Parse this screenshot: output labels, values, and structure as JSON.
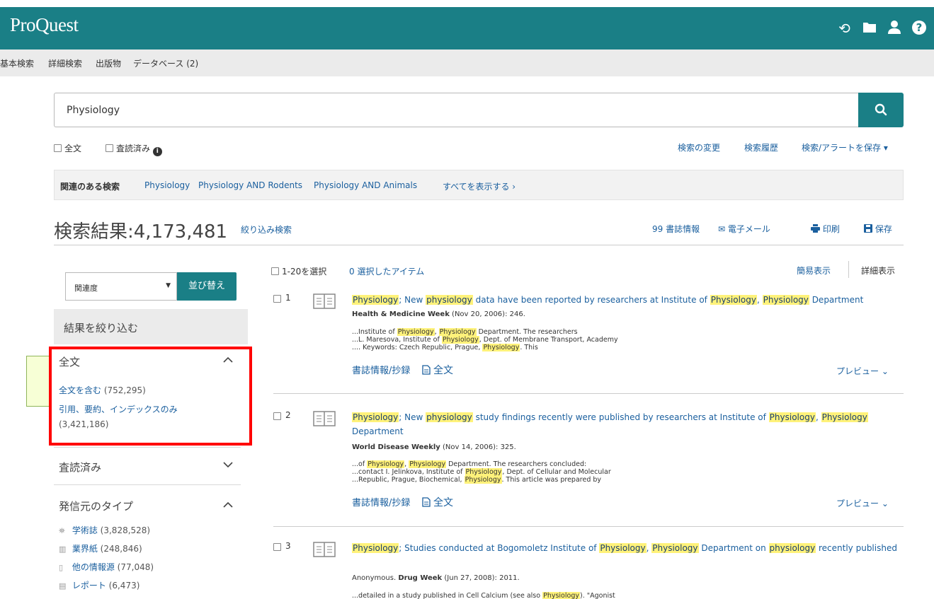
{
  "app": {
    "brand": "ProQuest",
    "top_icons": [
      "history-icon",
      "folder-icon",
      "user-icon",
      "help-icon"
    ]
  },
  "nav": {
    "basic": "基本検索",
    "advanced": "詳細検索",
    "publications": "出版物",
    "databases": "データベース (2)"
  },
  "search": {
    "query": "Physiology",
    "fulltext_label": "全文",
    "peer_label": "査読済み",
    "modify": "検索の変更",
    "history": "検索履歴",
    "save_alert": "検索/アラートを保存 ▾"
  },
  "related": {
    "label": "関連のある検索",
    "items": [
      "Physiology",
      "Physiology AND Rodents",
      "Physiology AND Animals"
    ],
    "show_all": "すべてを表示する ›"
  },
  "results": {
    "title": "検索結果:4,173,481",
    "refine": "絞り込み検索",
    "actions": {
      "cite": "99 書誌情報",
      "email": "✉ 電子メール",
      "print": "印刷",
      "save": "保存"
    },
    "select_range": "1-20を選択",
    "selected_items": "0 選択したアイテム",
    "brief_view": "簡易表示",
    "detailed_view": "詳細表示"
  },
  "sidebar": {
    "sort_value": "関連度",
    "sort_button": "並び替え",
    "narrow_header": "結果を絞り込む",
    "fulltext_facet": {
      "title": "全文",
      "items": [
        {
          "label": "全文を含む",
          "count": "(752,295)"
        },
        {
          "label": "引用、要約、インデックスのみ",
          "count": "(3,421,186)"
        }
      ]
    },
    "peer_facet": {
      "title": "査読済み"
    },
    "source_facet": {
      "title": "発信元のタイプ",
      "items": [
        {
          "icon": "scholarly-journal-icon",
          "label": "学術誌",
          "count": "(3,828,528)"
        },
        {
          "icon": "trade-journal-icon",
          "label": "業界紙",
          "count": "(248,846)"
        },
        {
          "icon": "other-sources-icon",
          "label": "他の情報源",
          "count": "(77,048)"
        },
        {
          "icon": "report-icon",
          "label": "レポート",
          "count": "(6,473)"
        }
      ]
    }
  },
  "items": [
    {
      "num": "1",
      "source_pub": "Health & Medicine Week",
      "source_rest": " (Nov 20, 2006): 246.",
      "links": {
        "abstract": "書誌情報/抄録",
        "fulltext": "全文",
        "preview": "プレビュー ⌄"
      }
    },
    {
      "num": "2",
      "source_pub": "World Disease Weekly",
      "source_rest": " (Nov 14, 2006): 325.",
      "links": {
        "abstract": "書誌情報/抄録",
        "fulltext": "全文",
        "preview": "プレビュー ⌄"
      }
    },
    {
      "num": "3",
      "source_pre": "Anonymous. ",
      "source_pub": "Drug Week",
      "source_rest": " (Jun 27, 2008): 2011."
    }
  ]
}
